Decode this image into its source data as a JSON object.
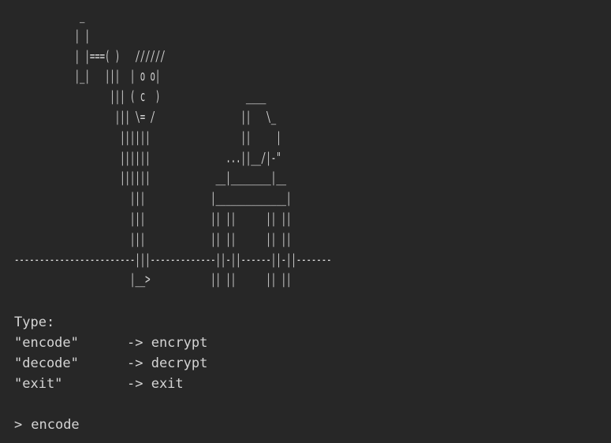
{
  "terminal": {
    "ascii_art": "             _\n            | |\n            | |===( )   //////\n            |_|   |||  | o o|\n                   ||| ( c  )                 ____\n                    ||| \\= /                 ||   \\_\n                     ||||||                  ||     |\n                     ||||||               ...||__/|-\"\n                     ||||||             __|________|__\n                       |||             |______________|\n                       |||             || ||      || ||\n                       |||             || ||      || ||\n------------------------|||-------------||-||------||-||-------\n                       |__>            || ||      || ||",
    "menu": {
      "heading": "Type:",
      "items": [
        {
          "command": "\"encode\"",
          "description": "-> encrypt"
        },
        {
          "command": "\"decode\"",
          "description": "-> decrypt"
        },
        {
          "command": "\"exit\"",
          "description": "-> exit"
        }
      ]
    },
    "prompt": {
      "symbol": ">",
      "input_value": "encode"
    }
  },
  "colors": {
    "background": "#272727",
    "foreground": "#d4d4d4"
  }
}
